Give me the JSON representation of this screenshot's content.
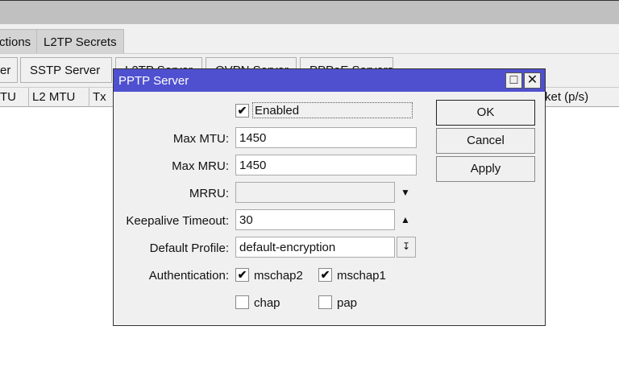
{
  "tabs": [
    "ctions",
    "L2TP Secrets"
  ],
  "toolbar": [
    "er",
    "SSTP Server",
    "L2TP Server",
    "OVPN Server",
    "PPPoE Servers"
  ],
  "columns": [
    "TU",
    "L2 MTU",
    "Tx",
    "ket (p/s)"
  ],
  "dialog": {
    "title": "PPTP Server",
    "enabled_label": "Enabled",
    "enabled": true,
    "max_mtu_label": "Max MTU:",
    "max_mtu": "1450",
    "max_mru_label": "Max MRU:",
    "max_mru": "1450",
    "mrru_label": "MRRU:",
    "mrru": "",
    "keepalive_label": "Keepalive Timeout:",
    "keepalive": "30",
    "profile_label": "Default Profile:",
    "profile": "default-encryption",
    "auth_label": "Authentication:",
    "auth": [
      {
        "label": "mschap2",
        "checked": true
      },
      {
        "label": "mschap1",
        "checked": true
      },
      {
        "label": "chap",
        "checked": false
      },
      {
        "label": "pap",
        "checked": false
      }
    ],
    "ok": "OK",
    "cancel": "Cancel",
    "apply": "Apply"
  }
}
